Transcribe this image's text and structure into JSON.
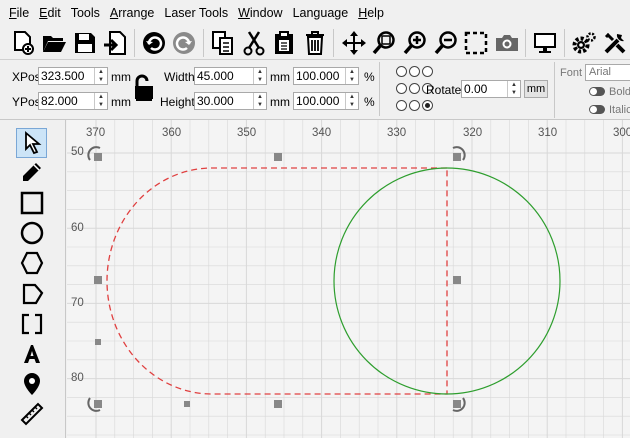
{
  "menubar": {
    "items": [
      {
        "label": "File",
        "mnemonic": "F",
        "rest": "ile"
      },
      {
        "label": "Edit",
        "mnemonic": "E",
        "rest": "dit"
      },
      {
        "label": "Tools",
        "mnemonic": "",
        "rest": "Tools"
      },
      {
        "label": "Arrange",
        "mnemonic": "A",
        "rest": "rrange"
      },
      {
        "label": "Laser Tools",
        "mnemonic": "",
        "rest": "Laser Tools"
      },
      {
        "label": "Window",
        "mnemonic": "W",
        "rest": "indow"
      },
      {
        "label": "Language",
        "mnemonic": "",
        "rest": "Language"
      },
      {
        "label": "Help",
        "mnemonic": "H",
        "rest": "elp"
      }
    ]
  },
  "toolbar": {
    "icons": [
      "new-file-icon",
      "open-folder-icon",
      "save-icon",
      "import-icon",
      "undo-icon",
      "redo-icon",
      "copy-icon",
      "cut-icon",
      "paste-icon",
      "delete-icon",
      "move-icon",
      "zoom-selection-icon",
      "zoom-in-icon",
      "zoom-out-icon",
      "zoom-fit-icon",
      "camera-icon",
      "monitor-icon",
      "settings-icon",
      "machine-settings-icon"
    ]
  },
  "properties": {
    "xpos_label": "XPos",
    "xpos_value": "323.500",
    "ypos_label": "YPos",
    "ypos_value": "82.000",
    "unit": "mm",
    "width_label": "Width",
    "width_value": "45.000",
    "height_label": "Height",
    "height_value": "30.000",
    "scale_w_value": "100.000",
    "scale_h_value": "100.000",
    "percent": "%",
    "rotate_label": "Rotate",
    "rotate_value": "0.00",
    "mm_button": "mm",
    "font_label": "Font",
    "font_value": "Arial",
    "bold_label": "Bold",
    "italic_label": "Italic"
  },
  "tools": [
    "select-tool-icon",
    "pencil-tool-icon",
    "rectangle-tool-icon",
    "ellipse-tool-icon",
    "polygon-tool-icon",
    "pentagon-tool-icon",
    "frame-tool-icon",
    "text-tool-icon",
    "position-tool-icon",
    "measure-tool-icon"
  ],
  "rulers": {
    "x_ticks": [
      "370",
      "360",
      "350",
      "340",
      "330",
      "320",
      "310",
      "300"
    ],
    "y_ticks": [
      "50",
      "60",
      "70",
      "80"
    ]
  },
  "colors": {
    "dashed_shape": "#e04040",
    "circle": "#2e9e2e",
    "handle": "#888888",
    "grid": "#d8d8d8",
    "selected_tool_bg": "#cce4f7"
  }
}
